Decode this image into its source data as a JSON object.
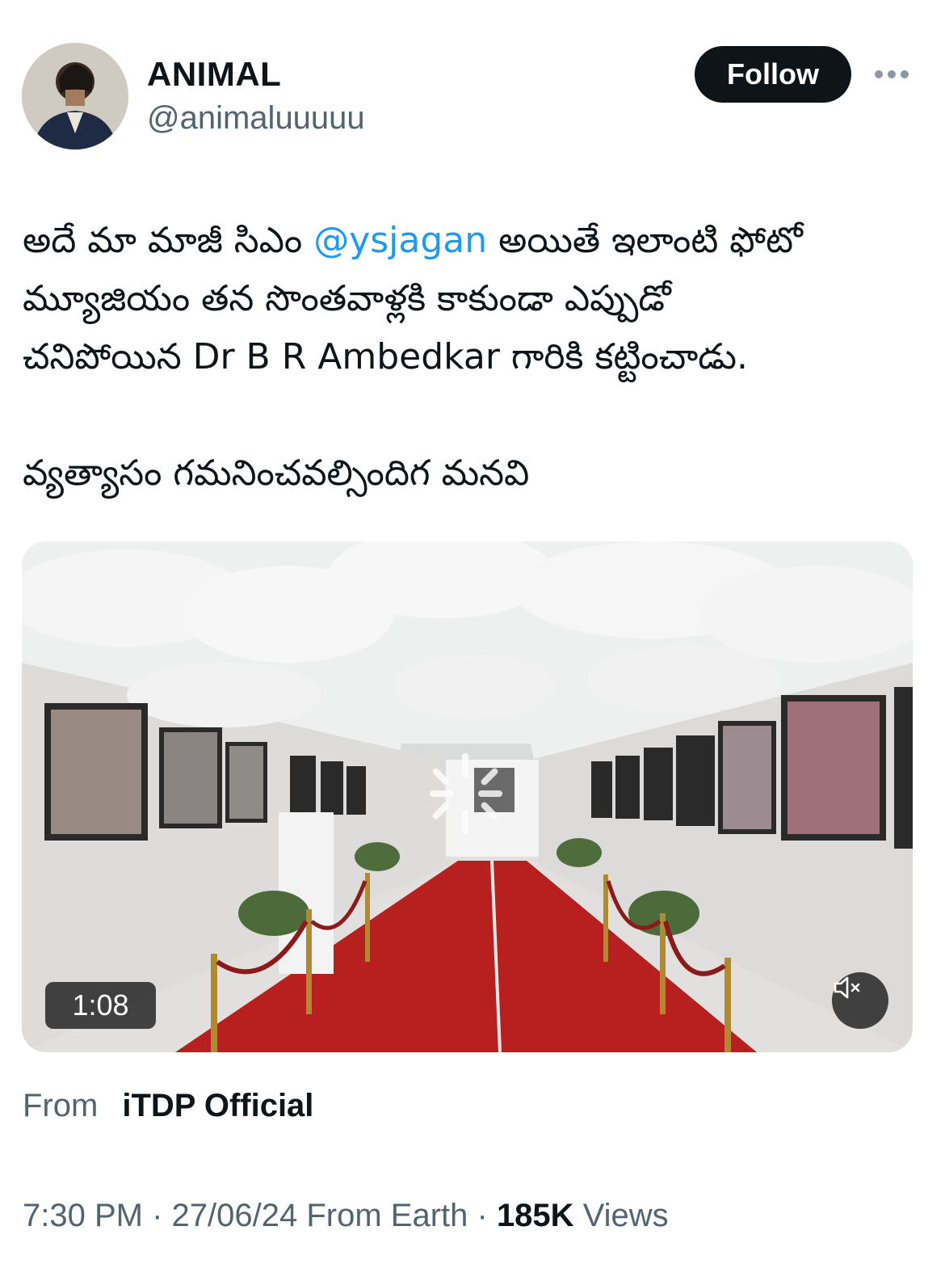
{
  "author": {
    "name": "ANIMAL",
    "handle": "@animaluuuuu",
    "follow_label": "Follow"
  },
  "tweet": {
    "line1_a": "అదే మా మాజీ సిఎం ",
    "mention": "@ysjagan",
    "line1_b": " అయితే ఇలాంటి ఫోటో",
    "line2": "మ్యూజియం తన సొంతవాళ్లకి కాకుండా ఎప్పుడో",
    "line3": "చనిపోయిన Dr B R Ambedkar గారికి కట్టించాడు.",
    "line4": "వ్యత్యాసం గమనించవల్సిందిగ మనవి"
  },
  "video": {
    "duration": "1:08",
    "muted": true
  },
  "source": {
    "from_label": "From",
    "name": "iTDP Official"
  },
  "meta": {
    "time": "7:30 PM",
    "separator": " · ",
    "date": "27/06/24",
    "location": "From Earth",
    "views_count": "185K",
    "views_label": "Views"
  },
  "colors": {
    "mention": "#1d9bf0",
    "secondary_text": "#536471",
    "carpet": "#b8201f"
  }
}
